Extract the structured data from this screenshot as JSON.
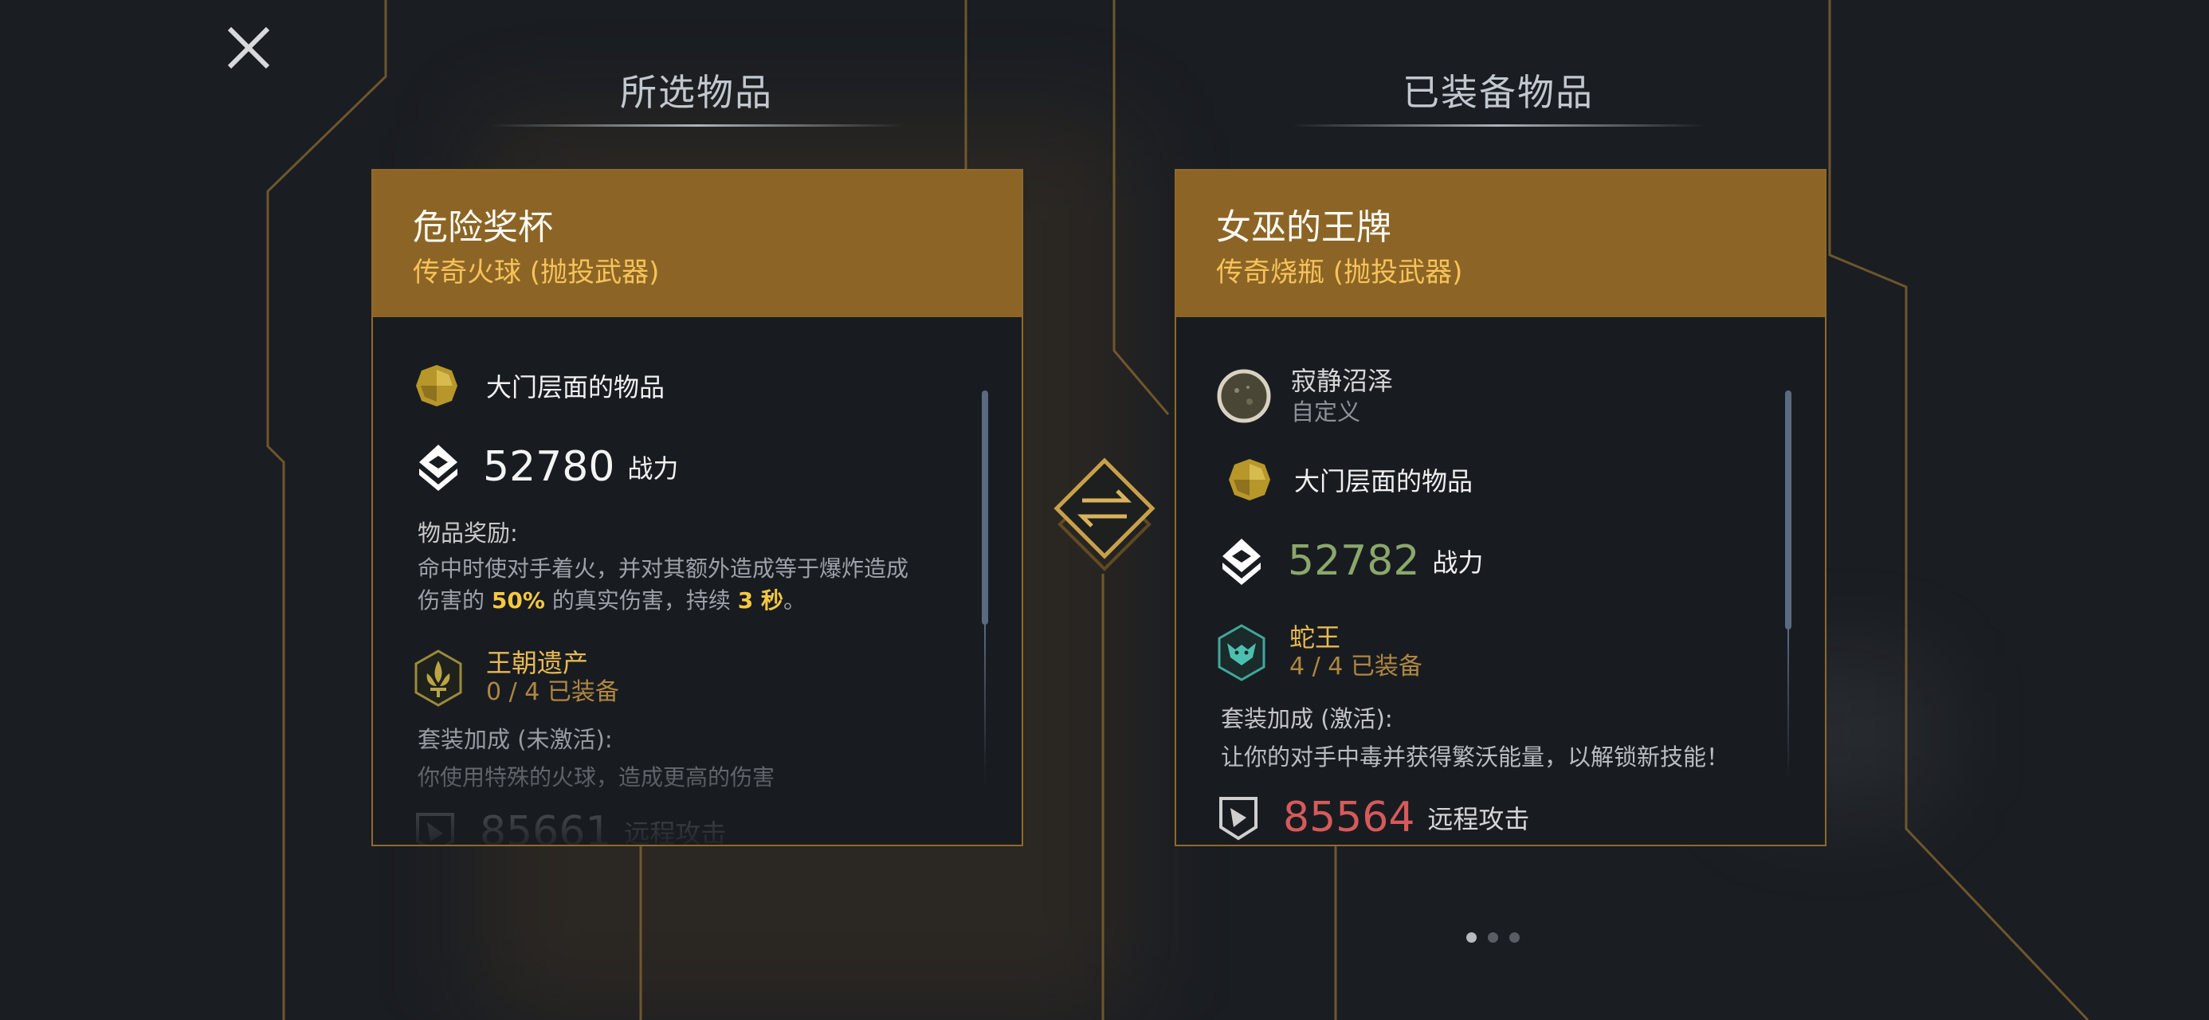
{
  "close_icon": "close-icon",
  "selected": {
    "heading": "所选物品",
    "item_name": "危险奖杯",
    "item_type": "传奇火球 (抛投武器)",
    "tier_text": "大门层面的物品",
    "power_value": "52780",
    "power_label": "战力",
    "bonus_label": "物品奖励:",
    "bonus_desc_1": "命中时使对手着火，并对其额外造成等于爆炸造成",
    "bonus_desc_2a": "伤害的",
    "bonus_pct": "50%",
    "bonus_desc_2b": "的真实伤害，持续",
    "bonus_dur": "3 秒",
    "bonus_desc_2c": "。",
    "set_name": "王朝遗产",
    "set_count": "0 / 4 已装备",
    "set_bonus_label": "套装加成 (未激活):",
    "set_bonus_desc": "你使用特殊的火球，造成更高的伤害",
    "ranged_value": "85661",
    "ranged_label": "远程攻击"
  },
  "equipped": {
    "heading": "已装备物品",
    "item_name": "女巫的王牌",
    "item_type": "传奇烧瓶 (抛投武器)",
    "custom_name": "寂静沼泽",
    "custom_label": "自定义",
    "tier_text": "大门层面的物品",
    "power_value": "52782",
    "power_label": "战力",
    "set_name": "蛇王",
    "set_count": "4 / 4 已装备",
    "set_bonus_label": "套装加成 (激活):",
    "set_bonus_desc": "让你的对手中毒并获得繁沃能量，以解锁新技能！",
    "ranged_value": "85564",
    "ranged_label": "远程攻击"
  },
  "swap_icon": "swap-icon",
  "pagination": {
    "count": 3,
    "active": 0
  },
  "colors": {
    "card_header": "#8c6526",
    "card_border": "#8f6a2a",
    "item_type": "#f6c35a",
    "power_higher": "#8aa86a",
    "ranged_lower": "#d65a5a",
    "set_name": "#e7b852"
  }
}
